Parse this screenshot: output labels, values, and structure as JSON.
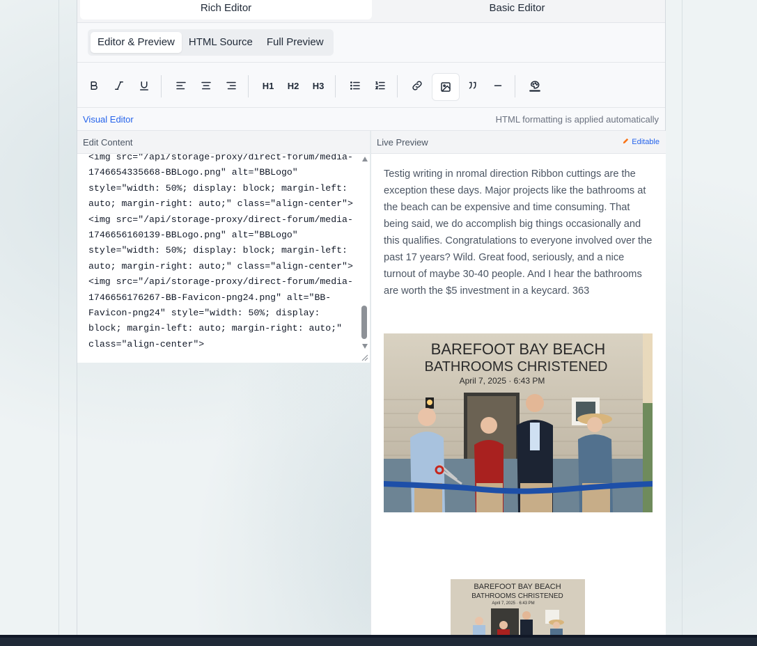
{
  "mode_tabs": {
    "rich": "Rich Editor",
    "basic": "Basic Editor"
  },
  "view_tabs": [
    "Editor & Preview",
    "HTML Source",
    "Full Preview"
  ],
  "toolbar": {
    "buttons": [
      "bold-icon",
      "italic-icon",
      "underline-icon",
      "align-left-icon",
      "align-center-icon",
      "align-right-icon",
      "heading-1-icon",
      "heading-2-icon",
      "heading-3-icon",
      "bullet-list-icon",
      "numbered-list-icon",
      "link-icon",
      "image-icon",
      "quote-icon",
      "horizontal-rule-icon",
      "text-color-icon"
    ],
    "h1": "H1",
    "h2": "H2",
    "h3": "H3"
  },
  "info": {
    "visual_editor": "Visual Editor",
    "auto_note": "HTML formatting is applied automatically"
  },
  "panes": {
    "edit_content": "Edit Content",
    "live_preview": "Live Preview",
    "editable": "Editable"
  },
  "source_lines": [
    "<img src=\"/api/storage-proxy/direct-forum/media-",
    "1746654335668-BBLogo.png\" alt=\"BBLogo\"",
    "style=\"width: 50%; display: block; margin-left:",
    "auto; margin-right: auto;\" class=\"align-center\">",
    "<img src=\"/api/storage-proxy/direct-forum/media-",
    "1746656160139-BBLogo.png\" alt=\"BBLogo\"",
    "style=\"width: 50%; display: block; margin-left:",
    "auto; margin-right: auto;\" class=\"align-center\">",
    "<img src=\"/api/storage-proxy/direct-forum/media-",
    "1746656176267-BB-Favicon-png24.png\" alt=\"BB-",
    "Favicon-png24\" style=\"width: 50%; display:",
    "block; margin-left: auto; margin-right: auto;\"",
    "class=\"align-center\">"
  ],
  "preview": {
    "body": "Testig writing in nromal direction Ribbon cuttings are the exception these days. Major projects like the bathrooms at the beach can be expensive and time consuming. That being said, we do accomplish big things occasionally and this qualifies. Congratulations to everyone involved over the past 17 years? Wild. Great food, seriously, and a nice turnout of maybe 30-40 people. And I hear the bathrooms are worth the $5 investment in a keycard.  363",
    "sign_line1": "BAREFOOT BAY BEACH",
    "sign_line2": "BATHROOMS CHRISTENED",
    "sign_date": "April 7, 2025 · 6:43 PM"
  },
  "colors": {
    "accent": "#2563eb",
    "ribbon": "#1d4fa8"
  }
}
